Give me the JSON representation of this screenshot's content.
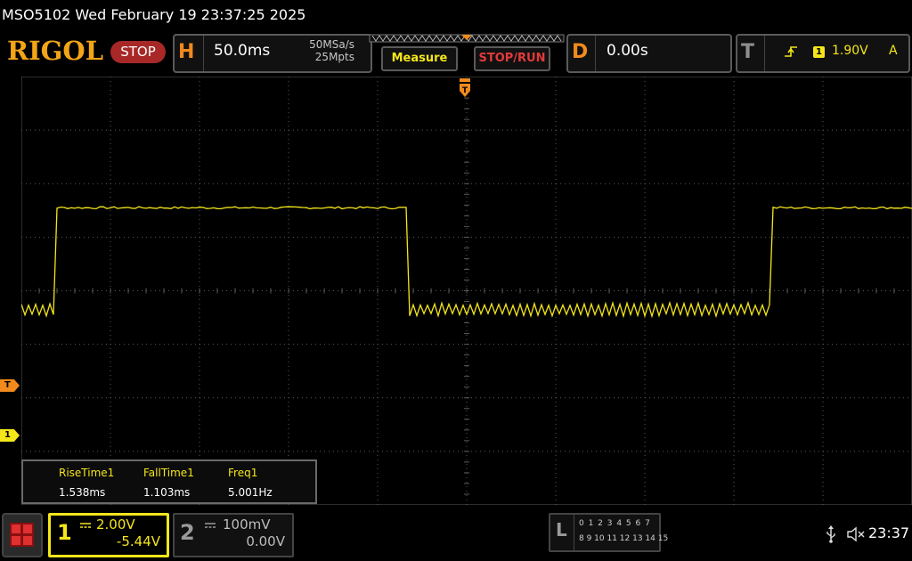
{
  "title_bar": {
    "text": "MSO5102  Wed February 19 23:37:25 2025"
  },
  "header": {
    "logo": "RIGOL",
    "run_state": "STOP",
    "horizontal": {
      "letter": "H",
      "timebase": "50.0ms",
      "sample_rate": "50MSa/s",
      "memory_depth": "25Mpts"
    },
    "measure_button": "Measure",
    "stoprun_button": "STOP/RUN",
    "delay": {
      "letter": "D",
      "value": "0.00s"
    },
    "trigger": {
      "letter": "T",
      "source": "1",
      "level": "1.90V",
      "mode": "A",
      "edge_icon": "rising-edge-icon"
    }
  },
  "markers": {
    "trigger_level": "T",
    "ch1_ground": "1"
  },
  "measurements": {
    "items": [
      {
        "label": "RiseTime1",
        "value": "1.538ms"
      },
      {
        "label": "FallTime1",
        "value": "1.103ms"
      },
      {
        "label": "Freq1",
        "value": "5.001Hz"
      }
    ]
  },
  "channels": {
    "ch1": {
      "number": "1",
      "scale": "2.00V",
      "offset": "-5.44V",
      "coupling_icon": "dc-coupling-icon",
      "color": "#f4e61a",
      "active": true
    },
    "ch2": {
      "number": "2",
      "scale": "100mV",
      "offset": "0.00V",
      "coupling_icon": "dc-coupling-icon",
      "color": "#9a9a9a",
      "active": false
    }
  },
  "logic_analyzer": {
    "letter": "L",
    "row1": "0 1 2 3  4 5 6 7",
    "row2": "8 9 10 11 12 13 14 15"
  },
  "status": {
    "clock": "23:37",
    "usb_icon": "usb-icon",
    "mute_icon": "speaker-muted-icon"
  },
  "colors": {
    "ch1": "#f4e61a",
    "accent_orange": "#f08a1c",
    "stop_red": "#a82828",
    "grid": "#5a5a5a"
  },
  "waveform": {
    "shape": "square",
    "period_divisions": 8.0,
    "high_level_div": 1.55,
    "low_level_div": -0.35,
    "low_noise_div": 0.25,
    "first_rising_edge_div": 0.4,
    "first_falling_edge_div": 4.35
  }
}
